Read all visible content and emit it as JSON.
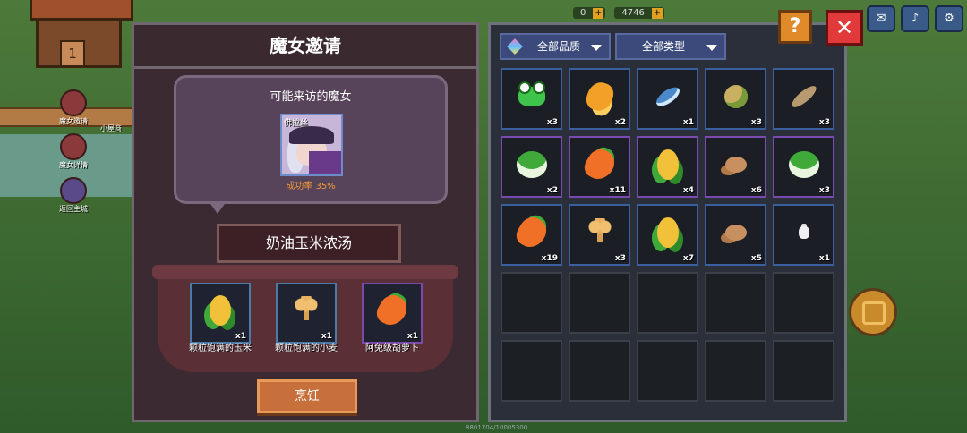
{
  "hud": {
    "counter1": "0",
    "counter2": "4746",
    "left_items": [
      "魔女邀请",
      "魔女详情",
      "返回主城"
    ],
    "left_items_partial": "小屋商"
  },
  "left_panel": {
    "title": "魔女邀请",
    "bubble_title": "可能来访的魔女",
    "witch_name": "佛拉丝",
    "success_rate": "成功率 35%",
    "dish_name": "奶油玉米浓汤",
    "ingredients": [
      {
        "icon": "corn-icon",
        "qty": "x1",
        "name": "颗粒饱满的玉米"
      },
      {
        "icon": "wheat-icon",
        "qty": "x1",
        "name": "颗粒饱满的小麦"
      },
      {
        "icon": "carrot-icon",
        "qty": "x1",
        "name": "阿兔级胡萝卜"
      }
    ],
    "cook_label": "烹饪"
  },
  "right_panel": {
    "filter_quality": "全部品质",
    "filter_type": "全部类型",
    "items": [
      {
        "icon": "frog-icon",
        "qty": "x3",
        "rarity": "blue"
      },
      {
        "icon": "goldfish-icon",
        "qty": "x2",
        "rarity": "blue"
      },
      {
        "icon": "bluefish-icon",
        "qty": "x1",
        "rarity": "blue"
      },
      {
        "icon": "pufferfish-icon",
        "qty": "x3",
        "rarity": "blue"
      },
      {
        "icon": "catfish-icon",
        "qty": "x3",
        "rarity": "blue"
      },
      {
        "icon": "cabbage-icon",
        "qty": "x2",
        "rarity": "purple"
      },
      {
        "icon": "carrot-icon",
        "qty": "x11",
        "rarity": "purple"
      },
      {
        "icon": "corn-icon",
        "qty": "x4",
        "rarity": "purple"
      },
      {
        "icon": "mushroom-icon",
        "qty": "x6",
        "rarity": "purple"
      },
      {
        "icon": "cabbage-icon",
        "qty": "x3",
        "rarity": "purple"
      },
      {
        "icon": "carrot-icon",
        "qty": "x19",
        "rarity": "blue"
      },
      {
        "icon": "wheat-icon",
        "qty": "x3",
        "rarity": "blue"
      },
      {
        "icon": "corn-icon",
        "qty": "x7",
        "rarity": "blue"
      },
      {
        "icon": "mushroom-icon",
        "qty": "x5",
        "rarity": "blue"
      },
      {
        "icon": "potion-icon",
        "qty": "x1",
        "rarity": "blue"
      }
    ],
    "empty_slots": 10
  },
  "buttons": {
    "help": "?",
    "close": "✕"
  },
  "footer": "8801704/10005300"
}
